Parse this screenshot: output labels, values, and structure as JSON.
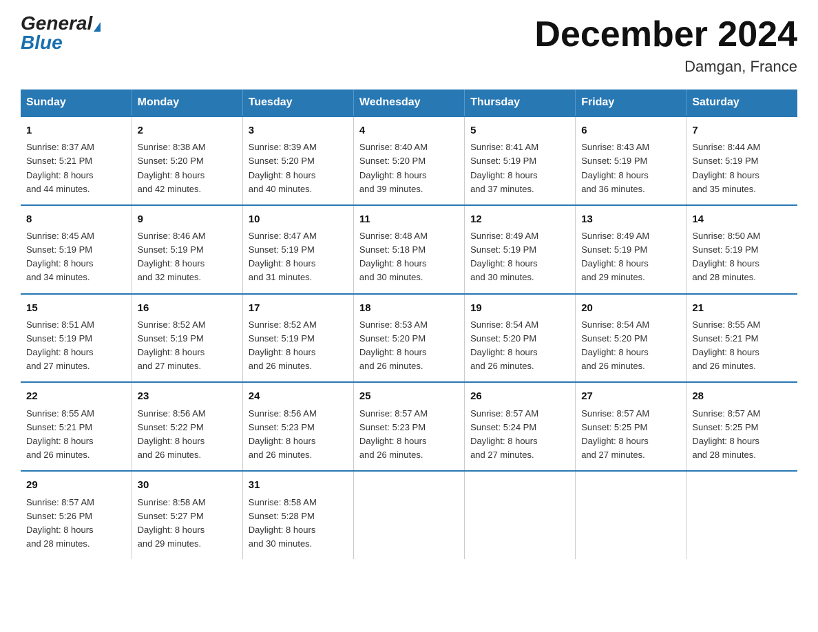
{
  "logo": {
    "general": "General",
    "blue": "Blue"
  },
  "header": {
    "month": "December 2024",
    "location": "Damgan, France"
  },
  "weekdays": [
    "Sunday",
    "Monday",
    "Tuesday",
    "Wednesday",
    "Thursday",
    "Friday",
    "Saturday"
  ],
  "weeks": [
    [
      {
        "day": "1",
        "info": "Sunrise: 8:37 AM\nSunset: 5:21 PM\nDaylight: 8 hours\nand 44 minutes."
      },
      {
        "day": "2",
        "info": "Sunrise: 8:38 AM\nSunset: 5:20 PM\nDaylight: 8 hours\nand 42 minutes."
      },
      {
        "day": "3",
        "info": "Sunrise: 8:39 AM\nSunset: 5:20 PM\nDaylight: 8 hours\nand 40 minutes."
      },
      {
        "day": "4",
        "info": "Sunrise: 8:40 AM\nSunset: 5:20 PM\nDaylight: 8 hours\nand 39 minutes."
      },
      {
        "day": "5",
        "info": "Sunrise: 8:41 AM\nSunset: 5:19 PM\nDaylight: 8 hours\nand 37 minutes."
      },
      {
        "day": "6",
        "info": "Sunrise: 8:43 AM\nSunset: 5:19 PM\nDaylight: 8 hours\nand 36 minutes."
      },
      {
        "day": "7",
        "info": "Sunrise: 8:44 AM\nSunset: 5:19 PM\nDaylight: 8 hours\nand 35 minutes."
      }
    ],
    [
      {
        "day": "8",
        "info": "Sunrise: 8:45 AM\nSunset: 5:19 PM\nDaylight: 8 hours\nand 34 minutes."
      },
      {
        "day": "9",
        "info": "Sunrise: 8:46 AM\nSunset: 5:19 PM\nDaylight: 8 hours\nand 32 minutes."
      },
      {
        "day": "10",
        "info": "Sunrise: 8:47 AM\nSunset: 5:19 PM\nDaylight: 8 hours\nand 31 minutes."
      },
      {
        "day": "11",
        "info": "Sunrise: 8:48 AM\nSunset: 5:18 PM\nDaylight: 8 hours\nand 30 minutes."
      },
      {
        "day": "12",
        "info": "Sunrise: 8:49 AM\nSunset: 5:19 PM\nDaylight: 8 hours\nand 30 minutes."
      },
      {
        "day": "13",
        "info": "Sunrise: 8:49 AM\nSunset: 5:19 PM\nDaylight: 8 hours\nand 29 minutes."
      },
      {
        "day": "14",
        "info": "Sunrise: 8:50 AM\nSunset: 5:19 PM\nDaylight: 8 hours\nand 28 minutes."
      }
    ],
    [
      {
        "day": "15",
        "info": "Sunrise: 8:51 AM\nSunset: 5:19 PM\nDaylight: 8 hours\nand 27 minutes."
      },
      {
        "day": "16",
        "info": "Sunrise: 8:52 AM\nSunset: 5:19 PM\nDaylight: 8 hours\nand 27 minutes."
      },
      {
        "day": "17",
        "info": "Sunrise: 8:52 AM\nSunset: 5:19 PM\nDaylight: 8 hours\nand 26 minutes."
      },
      {
        "day": "18",
        "info": "Sunrise: 8:53 AM\nSunset: 5:20 PM\nDaylight: 8 hours\nand 26 minutes."
      },
      {
        "day": "19",
        "info": "Sunrise: 8:54 AM\nSunset: 5:20 PM\nDaylight: 8 hours\nand 26 minutes."
      },
      {
        "day": "20",
        "info": "Sunrise: 8:54 AM\nSunset: 5:20 PM\nDaylight: 8 hours\nand 26 minutes."
      },
      {
        "day": "21",
        "info": "Sunrise: 8:55 AM\nSunset: 5:21 PM\nDaylight: 8 hours\nand 26 minutes."
      }
    ],
    [
      {
        "day": "22",
        "info": "Sunrise: 8:55 AM\nSunset: 5:21 PM\nDaylight: 8 hours\nand 26 minutes."
      },
      {
        "day": "23",
        "info": "Sunrise: 8:56 AM\nSunset: 5:22 PM\nDaylight: 8 hours\nand 26 minutes."
      },
      {
        "day": "24",
        "info": "Sunrise: 8:56 AM\nSunset: 5:23 PM\nDaylight: 8 hours\nand 26 minutes."
      },
      {
        "day": "25",
        "info": "Sunrise: 8:57 AM\nSunset: 5:23 PM\nDaylight: 8 hours\nand 26 minutes."
      },
      {
        "day": "26",
        "info": "Sunrise: 8:57 AM\nSunset: 5:24 PM\nDaylight: 8 hours\nand 27 minutes."
      },
      {
        "day": "27",
        "info": "Sunrise: 8:57 AM\nSunset: 5:25 PM\nDaylight: 8 hours\nand 27 minutes."
      },
      {
        "day": "28",
        "info": "Sunrise: 8:57 AM\nSunset: 5:25 PM\nDaylight: 8 hours\nand 28 minutes."
      }
    ],
    [
      {
        "day": "29",
        "info": "Sunrise: 8:57 AM\nSunset: 5:26 PM\nDaylight: 8 hours\nand 28 minutes."
      },
      {
        "day": "30",
        "info": "Sunrise: 8:58 AM\nSunset: 5:27 PM\nDaylight: 8 hours\nand 29 minutes."
      },
      {
        "day": "31",
        "info": "Sunrise: 8:58 AM\nSunset: 5:28 PM\nDaylight: 8 hours\nand 30 minutes."
      },
      {
        "day": "",
        "info": ""
      },
      {
        "day": "",
        "info": ""
      },
      {
        "day": "",
        "info": ""
      },
      {
        "day": "",
        "info": ""
      }
    ]
  ]
}
